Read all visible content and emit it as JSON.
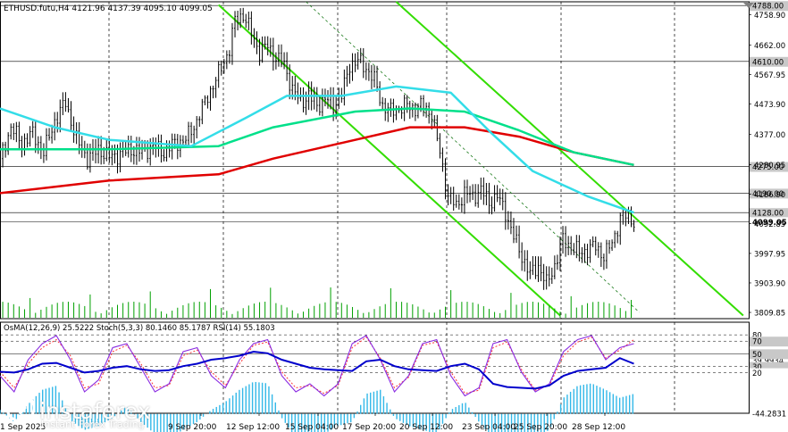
{
  "header": {
    "symbol_info": "ETHUSD.futu,H4  4121.96 4137.39 4095.10 4099.05"
  },
  "indicator_header": "OsMA(12,26,9) 25.5222  Stoch(5,3,3) 80.1460 85.1787  RSI(14) 55.1803",
  "logo": {
    "name": "instaforex",
    "tagline": "Instant Forex Trading"
  },
  "colors": {
    "candles": "#000000",
    "sma_slow": "#e00000",
    "sma_mid": "#00e08a",
    "sma_fast": "#33dde8",
    "channel": "#33dd00",
    "osma": "#33b8e8",
    "stoch_main": "#8a2be2",
    "stoch_signal": "#ff3333",
    "rsi": "#0000cc",
    "grid": "#000000"
  },
  "chart_data": [
    {
      "type": "candlestick",
      "symbol": "ETHUSD.futu",
      "timeframe": "H4",
      "ohlc_last": {
        "open": 4121.96,
        "high": 4137.39,
        "low": 4095.1,
        "close": 4099.05
      },
      "ylim": [
        3790,
        4800
      ],
      "y_ticks": [
        4758.9,
        4662.0,
        4567.95,
        4473.9,
        4377.0,
        4280.95,
        4186.9,
        4092.85,
        3997.95,
        3903.9,
        3809.85
      ],
      "level_labels": [
        {
          "value": 4788.0,
          "label": "4788.00"
        },
        {
          "value": 4610.0,
          "label": "4610.00"
        },
        {
          "value": 4275.0,
          "label": "4275.00"
        },
        {
          "value": 4190.0,
          "label": "4190.00"
        },
        {
          "value": 4128.0,
          "label": "4128.00"
        },
        {
          "value": 4099.05,
          "label": "4099.05"
        }
      ],
      "x_labels": [
        "1 Sep 2025",
        "9 Sep 20:00",
        "12 Sep 12:00",
        "15 Sep 04:00",
        "17 Sep 20:00",
        "20 Sep 12:00",
        "23 Sep 04:00",
        "25 Sep 20:00",
        "28 Sep 12:00"
      ],
      "trend": [
        {
          "t": 0,
          "p": 4300
        },
        {
          "t": 4,
          "p": 4400
        },
        {
          "t": 8,
          "p": 4350
        },
        {
          "t": 12,
          "p": 4380
        },
        {
          "t": 16,
          "p": 4320
        },
        {
          "t": 20,
          "p": 4420
        },
        {
          "t": 24,
          "p": 4480
        },
        {
          "t": 28,
          "p": 4360
        },
        {
          "t": 32,
          "p": 4300
        },
        {
          "t": 36,
          "p": 4330
        },
        {
          "t": 40,
          "p": 4305
        },
        {
          "t": 44,
          "p": 4315
        },
        {
          "t": 48,
          "p": 4330
        },
        {
          "t": 52,
          "p": 4320
        },
        {
          "t": 56,
          "p": 4340
        },
        {
          "t": 60,
          "p": 4320
        },
        {
          "t": 64,
          "p": 4350
        },
        {
          "t": 68,
          "p": 4360
        },
        {
          "t": 72,
          "p": 4420
        },
        {
          "t": 76,
          "p": 4500
        },
        {
          "t": 80,
          "p": 4570
        },
        {
          "t": 84,
          "p": 4650
        },
        {
          "t": 86,
          "p": 4740
        },
        {
          "t": 89,
          "p": 4760
        },
        {
          "t": 92,
          "p": 4700
        },
        {
          "t": 95,
          "p": 4640
        },
        {
          "t": 98,
          "p": 4660
        },
        {
          "t": 101,
          "p": 4620
        },
        {
          "t": 104,
          "p": 4600
        },
        {
          "t": 107,
          "p": 4520
        },
        {
          "t": 110,
          "p": 4480
        },
        {
          "t": 113,
          "p": 4500
        },
        {
          "t": 116,
          "p": 4470
        },
        {
          "t": 119,
          "p": 4490
        },
        {
          "t": 122,
          "p": 4470
        },
        {
          "t": 125,
          "p": 4500
        },
        {
          "t": 128,
          "p": 4600
        },
        {
          "t": 131,
          "p": 4610
        },
        {
          "t": 134,
          "p": 4590
        },
        {
          "t": 137,
          "p": 4550
        },
        {
          "t": 140,
          "p": 4470
        },
        {
          "t": 143,
          "p": 4450
        },
        {
          "t": 146,
          "p": 4460
        },
        {
          "t": 149,
          "p": 4470
        },
        {
          "t": 152,
          "p": 4460
        },
        {
          "t": 155,
          "p": 4470
        },
        {
          "t": 158,
          "p": 4440
        },
        {
          "t": 161,
          "p": 4320
        },
        {
          "t": 164,
          "p": 4180
        },
        {
          "t": 167,
          "p": 4150
        },
        {
          "t": 170,
          "p": 4190
        },
        {
          "t": 173,
          "p": 4180
        },
        {
          "t": 176,
          "p": 4200
        },
        {
          "t": 179,
          "p": 4160
        },
        {
          "t": 182,
          "p": 4180
        },
        {
          "t": 185,
          "p": 4130
        },
        {
          "t": 188,
          "p": 4050
        },
        {
          "t": 191,
          "p": 3990
        },
        {
          "t": 194,
          "p": 3930
        },
        {
          "t": 197,
          "p": 3960
        },
        {
          "t": 200,
          "p": 3900
        },
        {
          "t": 203,
          "p": 3960
        },
        {
          "t": 206,
          "p": 4040
        },
        {
          "t": 209,
          "p": 4020
        },
        {
          "t": 212,
          "p": 4000
        },
        {
          "t": 215,
          "p": 4010
        },
        {
          "t": 218,
          "p": 4020
        },
        {
          "t": 221,
          "p": 3990
        },
        {
          "t": 224,
          "p": 4030
        },
        {
          "t": 227,
          "p": 4110
        },
        {
          "t": 230,
          "p": 4120
        },
        {
          "t": 232,
          "p": 4099
        }
      ],
      "sma_slow": [
        [
          0,
          4190
        ],
        [
          40,
          4230
        ],
        [
          80,
          4250
        ],
        [
          100,
          4300
        ],
        [
          130,
          4360
        ],
        [
          150,
          4400
        ],
        [
          170,
          4400
        ],
        [
          190,
          4370
        ],
        [
          210,
          4320
        ],
        [
          232,
          4280
        ]
      ],
      "sma_mid": [
        [
          0,
          4330
        ],
        [
          40,
          4330
        ],
        [
          80,
          4340
        ],
        [
          100,
          4400
        ],
        [
          130,
          4450
        ],
        [
          150,
          4460
        ],
        [
          170,
          4450
        ],
        [
          190,
          4390
        ],
        [
          210,
          4320
        ],
        [
          232,
          4280
        ]
      ],
      "sma_fast": [
        [
          0,
          4460
        ],
        [
          20,
          4400
        ],
        [
          40,
          4360
        ],
        [
          70,
          4340
        ],
        [
          90,
          4430
        ],
        [
          105,
          4500
        ],
        [
          125,
          4500
        ],
        [
          145,
          4530
        ],
        [
          165,
          4510
        ],
        [
          180,
          4380
        ],
        [
          195,
          4260
        ],
        [
          215,
          4180
        ],
        [
          232,
          4128
        ]
      ],
      "channel_lines": [
        [
          [
            80,
            4790
          ],
          [
            205,
            3800
          ]
        ],
        [
          [
            145,
            4800
          ],
          [
            272,
            3800
          ]
        ]
      ],
      "dashed_line": [
        [
          112,
          4800
        ],
        [
          234,
          3810
        ]
      ]
    },
    {
      "type": "oscillator",
      "title": "OsMA(12,26,9) 25.5222  Stoch(5,3,3) 80.1460 85.1787  RSI(14) 55.1803",
      "ylim": [
        -44.2831,
        100
      ],
      "y_ticks": [
        {
          "value": 39.9934,
          "label": "39.9934"
        },
        {
          "value": 80,
          "label": "80"
        },
        {
          "value": 70,
          "label": "70"
        },
        {
          "value": 50,
          "label": "50"
        },
        {
          "value": 30,
          "label": "30"
        },
        {
          "value": 20,
          "label": "20"
        },
        {
          "value": -44.2831,
          "label": "-44.2831"
        }
      ],
      "series": [
        {
          "name": "OsMA",
          "values": [
            5,
            -10,
            12,
            30,
            35,
            -8,
            -20,
            -15,
            -5,
            10,
            -10,
            -25,
            -30,
            -20,
            -10,
            5,
            15,
            30,
            40,
            38,
            -5,
            -30,
            -40,
            -25,
            -15,
            -10,
            25,
            30,
            -5,
            -15,
            -20,
            -25,
            5,
            15,
            -10,
            -30,
            -35,
            -40,
            -30,
            -20,
            20,
            35,
            38,
            30,
            20,
            25
          ]
        },
        {
          "name": "Stoch main",
          "values": [
            40,
            20,
            60,
            80,
            90,
            60,
            20,
            35,
            75,
            80,
            50,
            20,
            30,
            70,
            75,
            40,
            25,
            60,
            80,
            85,
            40,
            20,
            30,
            15,
            30,
            80,
            90,
            60,
            20,
            40,
            80,
            85,
            40,
            15,
            25,
            80,
            85,
            45,
            20,
            30,
            70,
            85,
            90,
            60,
            75,
            80
          ]
        },
        {
          "name": "Stoch signal",
          "values": [
            45,
            25,
            55,
            75,
            85,
            65,
            25,
            30,
            70,
            78,
            55,
            25,
            28,
            65,
            72,
            45,
            28,
            55,
            78,
            82,
            45,
            25,
            28,
            18,
            28,
            75,
            88,
            62,
            25,
            38,
            78,
            82,
            45,
            18,
            22,
            75,
            82,
            48,
            22,
            28,
            65,
            82,
            88,
            62,
            72,
            85
          ]
        },
        {
          "name": "RSI",
          "values": [
            45,
            44,
            48,
            55,
            56,
            50,
            44,
            46,
            50,
            52,
            48,
            46,
            47,
            52,
            55,
            60,
            62,
            65,
            70,
            68,
            60,
            55,
            50,
            48,
            47,
            46,
            58,
            60,
            52,
            48,
            47,
            46,
            52,
            55,
            48,
            30,
            26,
            25,
            24,
            28,
            40,
            46,
            48,
            50,
            62,
            55
          ]
        }
      ]
    }
  ]
}
